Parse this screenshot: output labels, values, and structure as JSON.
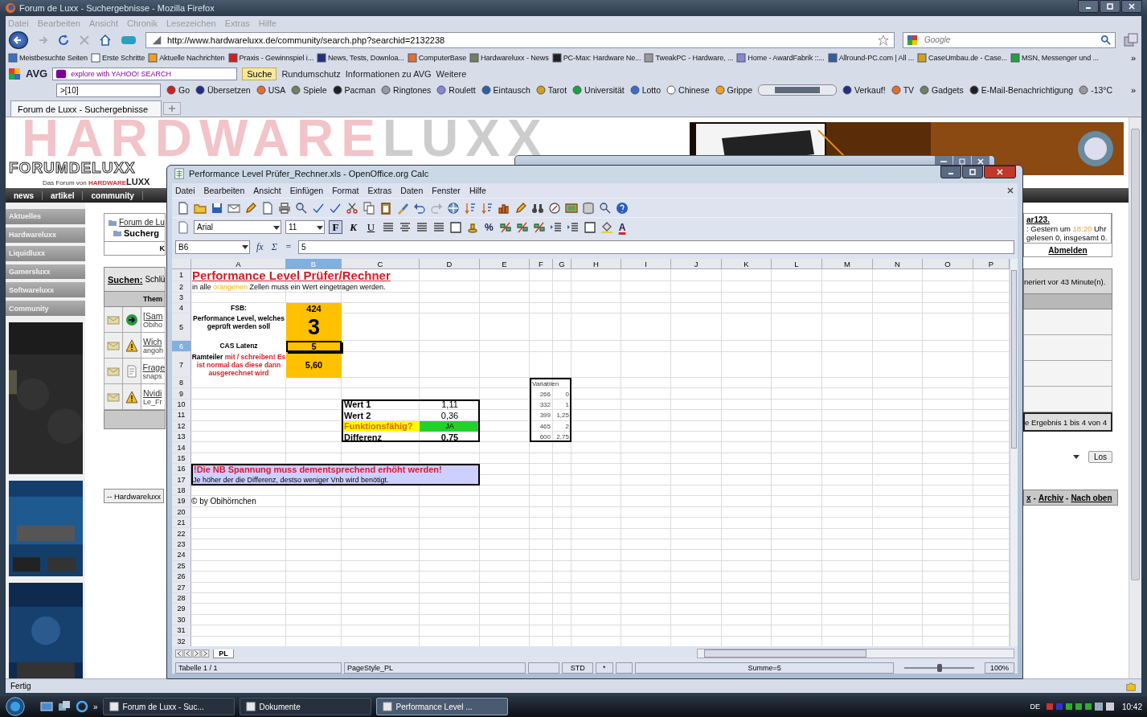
{
  "browser": {
    "title": "Forum de Luxx - Suchergebnisse - Mozilla Firefox",
    "menu": [
      {
        "label": "Datei",
        "disabled": true
      },
      {
        "label": "Bearbeiten",
        "disabled": true
      },
      {
        "label": "Ansicht",
        "disabled": true
      },
      {
        "label": "Chronik",
        "disabled": true
      },
      {
        "label": "Lesezeichen",
        "disabled": true
      },
      {
        "label": "Extras",
        "disabled": true
      },
      {
        "label": "Hilfe",
        "disabled": true
      }
    ],
    "address": "http://www.hardwareluxx.de/community/search.php?searchid=2132238",
    "search": {
      "placeholder": "Google"
    },
    "bookmarks": [
      "Meistbesuchte Seiten",
      "Erste Schritte",
      "Aktuelle Nachrichten",
      "Praxis - Gewinnspiel i...",
      "News, Tests, Downloa...",
      "ComputerBase",
      "Hardwareluxx - News",
      "PC-Max: Hardware Ne...",
      "TweakPC - Hardware, ...",
      "Home - AwardFabrik ::...",
      "Allround-PC.com | All ...",
      "CaseUmbau.de - Case...",
      "MSN, Messenger und ..."
    ],
    "bookmarks_more": "»",
    "avg": {
      "brand": "AVG",
      "search_placeholder": "explore with YAHOO! SEARCH",
      "search_button": "Suche",
      "items": [
        "Rundumschutz",
        "Informationen zu AVG",
        "Weitere"
      ]
    },
    "toolbar": {
      "field": ">[10]",
      "items": [
        {
          "kind": "button",
          "label": "Go"
        },
        {
          "kind": "button",
          "label": "Übersetzen"
        },
        {
          "kind": "button",
          "label": "USA"
        },
        {
          "kind": "button",
          "label": "Spiele"
        },
        {
          "kind": "button",
          "label": "Pacman"
        },
        {
          "kind": "button",
          "label": "Ringtones"
        },
        {
          "kind": "button",
          "label": "Roulett"
        },
        {
          "kind": "button",
          "label": "Eintausch"
        },
        {
          "kind": "button",
          "label": "Tarot"
        },
        {
          "kind": "button",
          "label": "Universität"
        },
        {
          "kind": "button",
          "label": "Lotto"
        },
        {
          "kind": "button",
          "label": "Chinese"
        },
        {
          "kind": "button",
          "label": "Grippe"
        },
        {
          "kind": "player"
        },
        {
          "kind": "button",
          "label": "Verkauf!"
        },
        {
          "kind": "button",
          "label": "TV"
        },
        {
          "kind": "button",
          "label": "Gadgets"
        },
        {
          "kind": "button",
          "label": "E-Mail-Benachrichtigung"
        },
        {
          "kind": "button",
          "label": "-13°C"
        }
      ],
      "more": "»"
    },
    "tabs": [
      {
        "label": "Forum de Luxx - Suchergebnisse",
        "selected": true
      }
    ],
    "status": "Fertig"
  },
  "forum": {
    "banner_left": "HARDWARE",
    "banner_right": "LUXX",
    "logo": "FORUMDELUXX",
    "tagline": "Das Forum von",
    "tagline_brand": "HARDWARE",
    "tagline_suffix": "LUXX",
    "nav": [
      "news",
      "artikel",
      "community"
    ],
    "sidebar": [
      "Aktuelles",
      "Hardwareluxx",
      "Liquidluxx",
      "Gamersluxx",
      "Softwareluxx",
      "Community"
    ],
    "breadcrumb": [
      "Forum de Lu",
      "Sucherg"
    ],
    "column_3": "K",
    "search_label": "Suchen:",
    "search_text": "Schlü",
    "table_header": "Them",
    "results": [
      {
        "kind": "arrow",
        "title": "[Sam",
        "author": "Obiho"
      },
      {
        "kind": "warning",
        "title": "Wich",
        "author": "angoh"
      },
      {
        "kind": "note",
        "title": "Frage",
        "author": "snaps"
      },
      {
        "kind": "warning",
        "title": "Nvidi",
        "author": "Le_Fr"
      }
    ],
    "forum_select": "-- Hardwareluxx",
    "user": "ar123.",
    "last_visit": [
      {
        "text": ": Gestern um ",
        "highlight": false
      },
      {
        "text": "18:20",
        "highlight": true
      },
      {
        "text": " Uhr",
        "highlight": false
      }
    ],
    "messages": "gelesen 0, insgesamt 0.",
    "logout": "Abmelden",
    "generated": "neriert vor 43 Minute(n).",
    "result_count": "e Ergebnis 1 bis 4 von 4",
    "go": "Los",
    "footer": [
      {
        "kind": "link",
        "text": "x"
      },
      {
        "kind": "separator",
        "text": "-"
      },
      {
        "kind": "link",
        "text": "Archiv"
      },
      {
        "kind": "separator",
        "text": "-"
      },
      {
        "kind": "link",
        "text": "Nach oben"
      }
    ]
  },
  "calc": {
    "title": "Performance Level Prüfer_Rechner.xls - OpenOffice.org Calc",
    "menu": [
      "Datei",
      "Bearbeiten",
      "Ansicht",
      "Einfügen",
      "Format",
      "Extras",
      "Daten",
      "Fenster",
      "Hilfe"
    ],
    "font": "Arial",
    "size": "11",
    "format_buttons": [
      {
        "label": "F",
        "selected": true
      },
      {
        "label": "K",
        "selected": false
      },
      {
        "label": "U",
        "selected": false
      }
    ],
    "percent": "%",
    "font_color": "A",
    "name_box": "B6",
    "formula_symbols": [
      "fx",
      "Σ",
      "="
    ],
    "formula": "5",
    "columns": [
      {
        "label": "A",
        "selected": false
      },
      {
        "label": "B",
        "selected": true
      },
      {
        "label": "C",
        "selected": false
      },
      {
        "label": "D",
        "selected": false
      },
      {
        "label": "E",
        "selected": false
      },
      {
        "label": "F",
        "selected": false
      },
      {
        "label": "G",
        "selected": false
      },
      {
        "label": "H",
        "selected": false
      },
      {
        "label": "I",
        "selected": false
      },
      {
        "label": "J",
        "selected": false
      },
      {
        "label": "K",
        "selected": false
      },
      {
        "label": "L",
        "selected": false
      },
      {
        "label": "M",
        "selected": false
      },
      {
        "label": "N",
        "selected": false
      },
      {
        "label": "O",
        "selected": false
      },
      {
        "label": "P",
        "selected": false
      }
    ],
    "rows": [
      {
        "number": "1",
        "selected": false,
        "cells": {
          "A": {
            "kind": "title",
            "text": "Performance Level Prüfer/Rechner",
            "selected": false
          }
        }
      },
      {
        "number": "2",
        "selected": false,
        "cells": {
          "A": {
            "kind": "note",
            "selected": false,
            "segments": [
              {
                "text": "in alle ",
                "highlight": false
              },
              {
                "text": "orangenen",
                "highlight": true
              },
              {
                "text": " Zellen muss ein Wert eingetragen werden.",
                "highlight": false
              }
            ]
          }
        }
      },
      {
        "number": "3",
        "selected": false
      },
      {
        "number": "4",
        "selected": false,
        "cells": {
          "A": {
            "kind": "label",
            "text": "FSB:",
            "selected": false
          },
          "B": {
            "kind": "input",
            "text": "424",
            "selected": false
          }
        }
      },
      {
        "number": "5",
        "selected": false,
        "cells": {
          "A": {
            "kind": "label",
            "text": "Performance Level, welches geprüft werden soll",
            "selected": false
          },
          "B": {
            "kind": "input-large",
            "text": "3",
            "selected": false
          }
        }
      },
      {
        "number": "6",
        "selected": true,
        "cells": {
          "A": {
            "kind": "label",
            "text": "CAS Latenz",
            "selected": false
          },
          "B": {
            "kind": "input",
            "text": "5",
            "selected": true
          }
        }
      },
      {
        "number": "7",
        "selected": false,
        "cells": {
          "A": {
            "kind": "label",
            "selected": false,
            "segments": [
              {
                "text": "Ramteiler ",
                "highlight": false
              },
              {
                "text": "mit / schreiben! Es ist normal das diese dann ausgerechnet wird",
                "highlight": true
              }
            ]
          },
          "B": {
            "kind": "input",
            "text": "5,60",
            "selected": false
          }
        }
      },
      {
        "number": "8",
        "selected": false,
        "cells": {
          "F": {
            "kind": "var-head",
            "text": "Variablen",
            "selected": false
          }
        }
      },
      {
        "number": "9",
        "selected": false,
        "cells": {
          "F": {
            "kind": "var",
            "text": "266",
            "selected": false
          },
          "G": {
            "kind": "var",
            "text": "0",
            "selected": false
          }
        }
      },
      {
        "number": "10",
        "selected": false,
        "cells": {
          "C": {
            "kind": "result-label",
            "text": "Wert 1",
            "selected": false
          },
          "D": {
            "kind": "result-value",
            "text": "1,11",
            "selected": false
          },
          "F": {
            "kind": "var",
            "text": "332",
            "selected": false
          },
          "G": {
            "kind": "var",
            "text": "1",
            "selected": false
          }
        }
      },
      {
        "number": "11",
        "selected": false,
        "cells": {
          "C": {
            "kind": "result-label",
            "text": "Wert 2",
            "selected": false
          },
          "D": {
            "kind": "result-value",
            "text": "0,36",
            "selected": false
          },
          "F": {
            "kind": "var",
            "text": "399",
            "selected": false
          },
          "G": {
            "kind": "var",
            "text": "1,25",
            "selected": false
          }
        }
      },
      {
        "number": "12",
        "selected": false,
        "cells": {
          "C": {
            "kind": "status-label",
            "text": "Funktionsfähig?",
            "selected": false
          },
          "D": {
            "kind": "status-ok",
            "text": "JA",
            "selected": false
          },
          "F": {
            "kind": "var",
            "text": "465",
            "selected": false
          },
          "G": {
            "kind": "var",
            "text": "2",
            "selected": false
          }
        }
      },
      {
        "number": "13",
        "selected": false,
        "cells": {
          "C": {
            "kind": "result-label",
            "text": "Differenz",
            "selected": false
          },
          "D": {
            "kind": "result-bold",
            "text": "0,75",
            "selected": false
          },
          "F": {
            "kind": "var",
            "text": "600",
            "selected": false
          },
          "G": {
            "kind": "var",
            "text": "2,75",
            "selected": false
          }
        }
      },
      {
        "number": "14",
        "selected": false
      },
      {
        "number": "15",
        "selected": false
      },
      {
        "number": "16",
        "selected": false,
        "cells": {
          "A": {
            "kind": "banner-title",
            "text": "!Die NB Spannung muss dementsprechend erhöht werden!",
            "selected": false
          }
        }
      },
      {
        "number": "17",
        "selected": false,
        "cells": {
          "A": {
            "kind": "banner-text",
            "text": "Je höher der die Differenz, destso weniger Vnb wird benötigt.",
            "selected": false
          }
        }
      },
      {
        "number": "18",
        "selected": false
      },
      {
        "number": "19",
        "selected": false,
        "cells": {
          "A": {
            "kind": "credit",
            "text": "© by Obihörnchen",
            "selected": false
          }
        }
      },
      {
        "number": "20",
        "selected": false
      },
      {
        "number": "21",
        "selected": false
      },
      {
        "number": "22",
        "selected": false
      },
      {
        "number": "23",
        "selected": false
      },
      {
        "number": "24",
        "selected": false
      },
      {
        "number": "25",
        "selected": false
      },
      {
        "number": "26",
        "selected": false
      },
      {
        "number": "27",
        "selected": false
      },
      {
        "number": "28",
        "selected": false
      },
      {
        "number": "29",
        "selected": false
      },
      {
        "number": "30",
        "selected": false
      },
      {
        "number": "31",
        "selected": false
      },
      {
        "number": "32",
        "selected": false
      }
    ],
    "sheet_tabs": [
      {
        "label": "PL",
        "selected": true
      }
    ],
    "status": {
      "sheet": "Tabelle 1 / 1",
      "page_style": "PageStyle_PL",
      "mode": "STD",
      "modified": "*",
      "sum": "Summe=5",
      "zoom": "100%"
    },
    "zoom_slider": {
      "level": 0.5
    }
  },
  "taskbar": {
    "more": "»",
    "tasks": [
      {
        "label": "Forum de Luxx - Suc...",
        "selected": false
      },
      {
        "label": "Dokumente",
        "selected": false
      },
      {
        "label": "Performance Level ...",
        "selected": true
      }
    ],
    "language": "DE",
    "clock": "10:42"
  }
}
